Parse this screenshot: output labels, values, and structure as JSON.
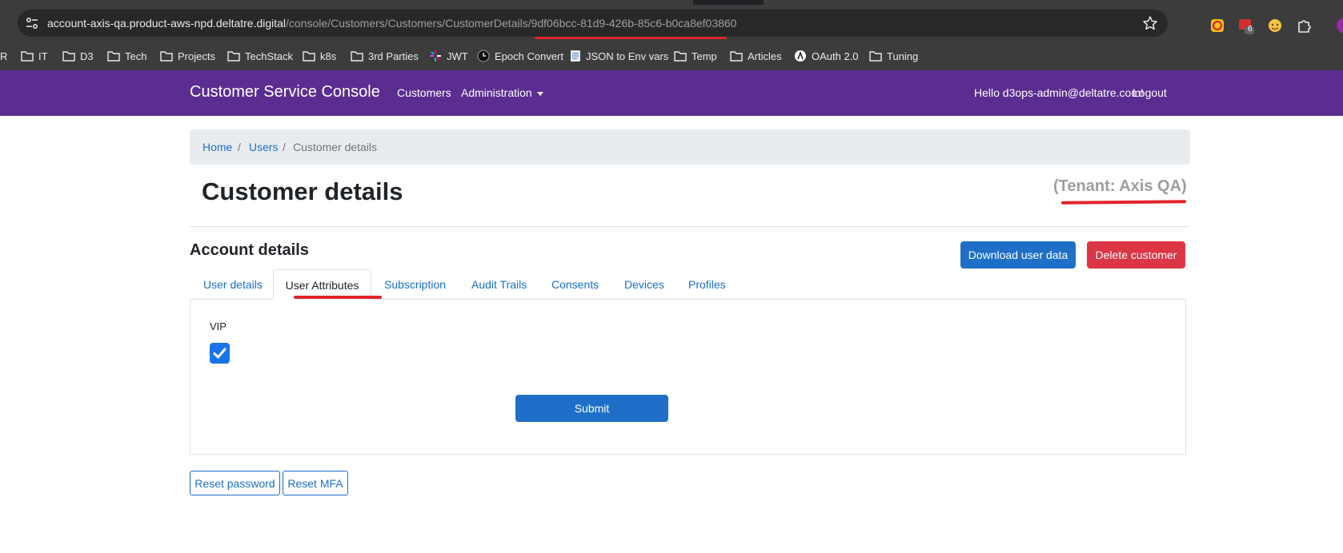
{
  "browser": {
    "url_host": "account-axis-qa.product-aws-npd.deltatre.digital",
    "url_path": "/console/Customers/Customers/CustomerDetails/",
    "url_id": "9df06bcc-81d9-426b-85c6-b0ca8ef03860",
    "extension_badge": "6",
    "bookmarks": [
      {
        "label": "R",
        "icon": "none"
      },
      {
        "label": "IT",
        "icon": "folder-icon"
      },
      {
        "label": "D3",
        "icon": "folder-icon"
      },
      {
        "label": "Tech",
        "icon": "folder-icon"
      },
      {
        "label": "Projects",
        "icon": "folder-icon"
      },
      {
        "label": "TechStack",
        "icon": "folder-icon"
      },
      {
        "label": "k8s",
        "icon": "folder-icon"
      },
      {
        "label": "3rd Parties",
        "icon": "folder-icon"
      },
      {
        "label": "JWT",
        "icon": "jwt-icon"
      },
      {
        "label": "Epoch Convert",
        "icon": "clock-icon"
      },
      {
        "label": "JSON to Env vars",
        "icon": "page-icon"
      },
      {
        "label": "Temp",
        "icon": "folder-icon"
      },
      {
        "label": "Articles",
        "icon": "folder-icon"
      },
      {
        "label": "OAuth 2.0",
        "icon": "oauth-icon"
      },
      {
        "label": "Tuning",
        "icon": "folder-icon"
      }
    ]
  },
  "navbar": {
    "brand": "Customer Service Console",
    "customers_link": "Customers",
    "administration_link": "Administration",
    "greeting": "Hello d3ops-admin@deltatre.com!",
    "logout_link": "Logout",
    "color": "#5b2d90"
  },
  "breadcrumb": {
    "home": "Home",
    "separator": "/",
    "users": "Users",
    "current": "Customer details"
  },
  "page": {
    "title": "Customer details",
    "tenant": "(Tenant: Axis QA)"
  },
  "account": {
    "section_title": "Account details",
    "download_button": "Download user data",
    "delete_button": "Delete customer",
    "tabs": [
      "User details",
      "User Attributes",
      "Subscription",
      "Audit Trails",
      "Consents",
      "Devices",
      "Profiles"
    ],
    "active_tab": "User Attributes"
  },
  "attributes": {
    "vip_label": "VIP",
    "vip_checked": true,
    "submit_button": "Submit"
  },
  "actions": {
    "reset_password": "Reset password",
    "reset_mfa": "Reset MFA"
  },
  "colors": {
    "primary": "#1f6fc9",
    "danger": "#dc3545",
    "annotation": "#e0252b"
  }
}
